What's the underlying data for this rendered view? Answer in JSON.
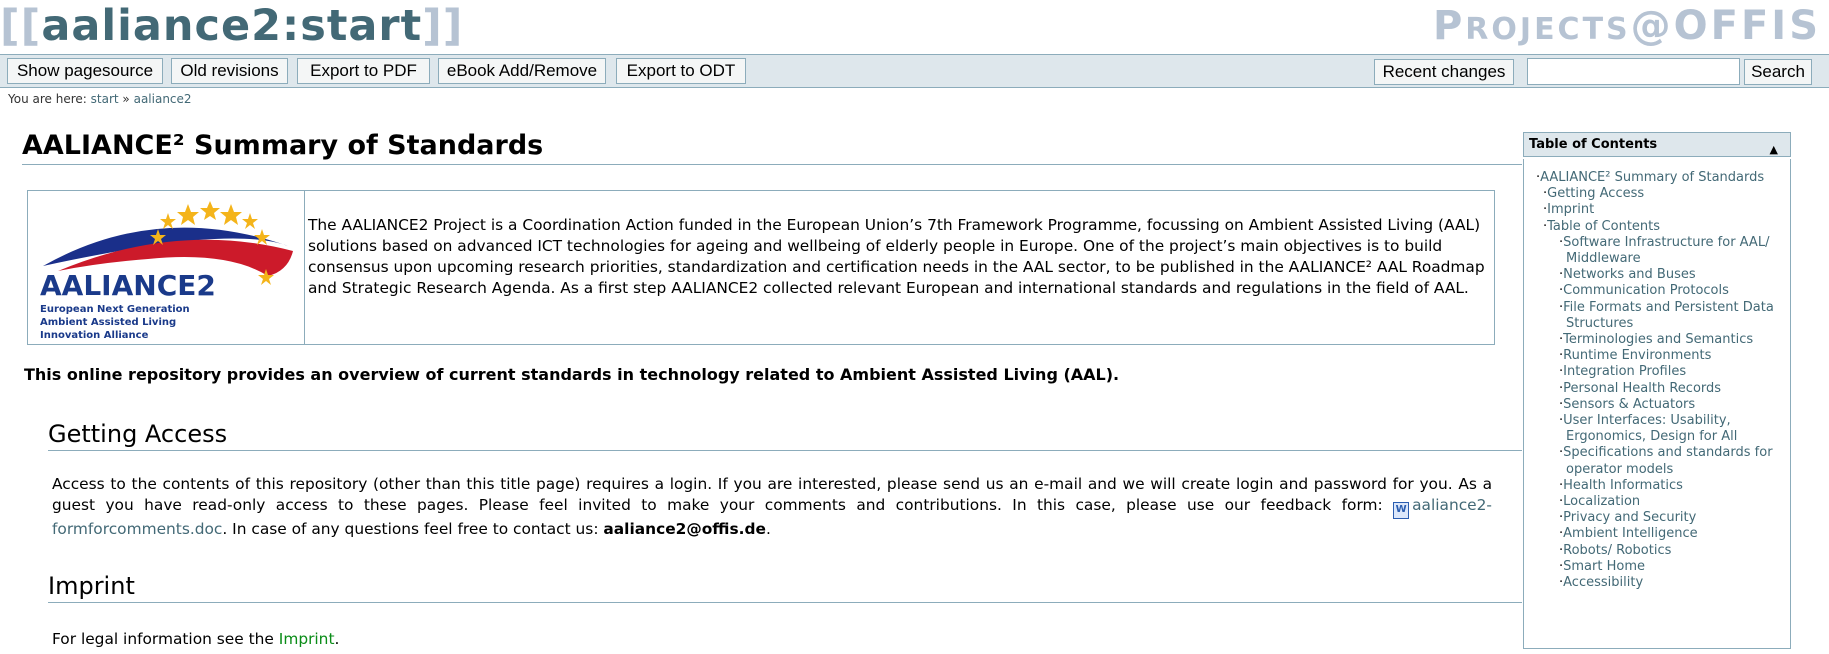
{
  "header": {
    "wiki_title": "aaliance2:start",
    "open_bracket": "[[",
    "close_bracket": "]]",
    "site_name_first": "P",
    "site_name_rest": "ROJECTS",
    "site_name_at": "@OFFIS"
  },
  "toolbar": {
    "show_pagesource": "Show pagesource",
    "old_revisions": "Old revisions",
    "export_pdf": "Export to PDF",
    "ebook": "eBook Add/Remove",
    "export_odt": "Export to ODT",
    "recent_changes": "Recent changes",
    "search_value": "",
    "search_button": "Search"
  },
  "breadcrumb": {
    "prefix": "You are here:",
    "start": "start",
    "separator": "»",
    "current": "aaliance2"
  },
  "main": {
    "title": "AALIANCE² Summary of Standards",
    "logo": {
      "name": "AALIANCE2",
      "tagline": [
        "European Next Generation",
        "Ambient Assisted Living",
        "Innovation Alliance"
      ]
    },
    "intro": "The AALIANCE2 Project is a Coordination Action funded in the European Union’s 7th Framework Programme, focussing on Ambient Assisted Living (AAL) solutions based on advanced ICT technologies for ageing and wellbeing of elderly people in Europe. One of the project’s main objectives is to build consensus upon upcoming research priorities, standardization and certification needs in the AAL sector, to be published in the AALIANCE² AAL Roadmap and Strategic Research Agenda. As a first step AALIANCE2 collected relevant European and international standards and regulations in the field of AAL.",
    "bold_line": "This online repository provides an overview of current standards in technology related to Ambient Assisted Living (AAL).",
    "getting_access": {
      "heading": "Getting Access",
      "text_before": "Access to the contents of this repository (other than this title page) requires a login. If you are interested, please send us an e-mail and we will create login and password for you. As a guest you have read-only access to these pages. Please feel invited to make your comments and contributions. In this case, please use our feedback form: ",
      "file_link": "aaliance2-formforcomments.doc",
      "text_after": ". In case of any questions feel free to contact us: ",
      "email": "aaliance2@offis.de",
      "end": "."
    },
    "imprint": {
      "heading": "Imprint",
      "text_before": "For legal information see the ",
      "link": "Imprint",
      "end": "."
    }
  },
  "toc": {
    "title": "Table of Contents",
    "items": [
      {
        "label": "AALIANCE² Summary of Standards",
        "level": 1
      },
      {
        "label": "Getting Access",
        "level": 2
      },
      {
        "label": "Imprint",
        "level": 2
      },
      {
        "label": "Table of Contents",
        "level": 2
      },
      {
        "label": "Software Infrastructure for AAL/ Middleware",
        "level": 3
      },
      {
        "label": "Networks and Buses",
        "level": 3
      },
      {
        "label": "Communication Protocols",
        "level": 3
      },
      {
        "label": "File Formats and Persistent Data Structures",
        "level": 3
      },
      {
        "label": "Terminologies and Semantics",
        "level": 3
      },
      {
        "label": "Runtime Environments",
        "level": 3
      },
      {
        "label": "Integration Profiles",
        "level": 3
      },
      {
        "label": "Personal Health Records",
        "level": 3
      },
      {
        "label": "Sensors & Actuators",
        "level": 3
      },
      {
        "label": "User Interfaces: Usability, Ergonomics, Design for All",
        "level": 3
      },
      {
        "label": "Specifications and standards for operator models",
        "level": 3
      },
      {
        "label": "Health Informatics",
        "level": 3
      },
      {
        "label": "Localization",
        "level": 3
      },
      {
        "label": "Privacy and Security",
        "level": 3
      },
      {
        "label": "Ambient Intelligence",
        "level": 3
      },
      {
        "label": "Robots/ Robotics",
        "level": 3
      },
      {
        "label": "Smart Home",
        "level": 3
      },
      {
        "label": "Accessibility",
        "level": 3
      }
    ]
  },
  "colors": {
    "link": "#436976",
    "border": "#8cacbb",
    "toolbar_bg": "#dee7ec",
    "title_bracket": "#b6c3d3",
    "internal_link": "#0a8c17"
  }
}
